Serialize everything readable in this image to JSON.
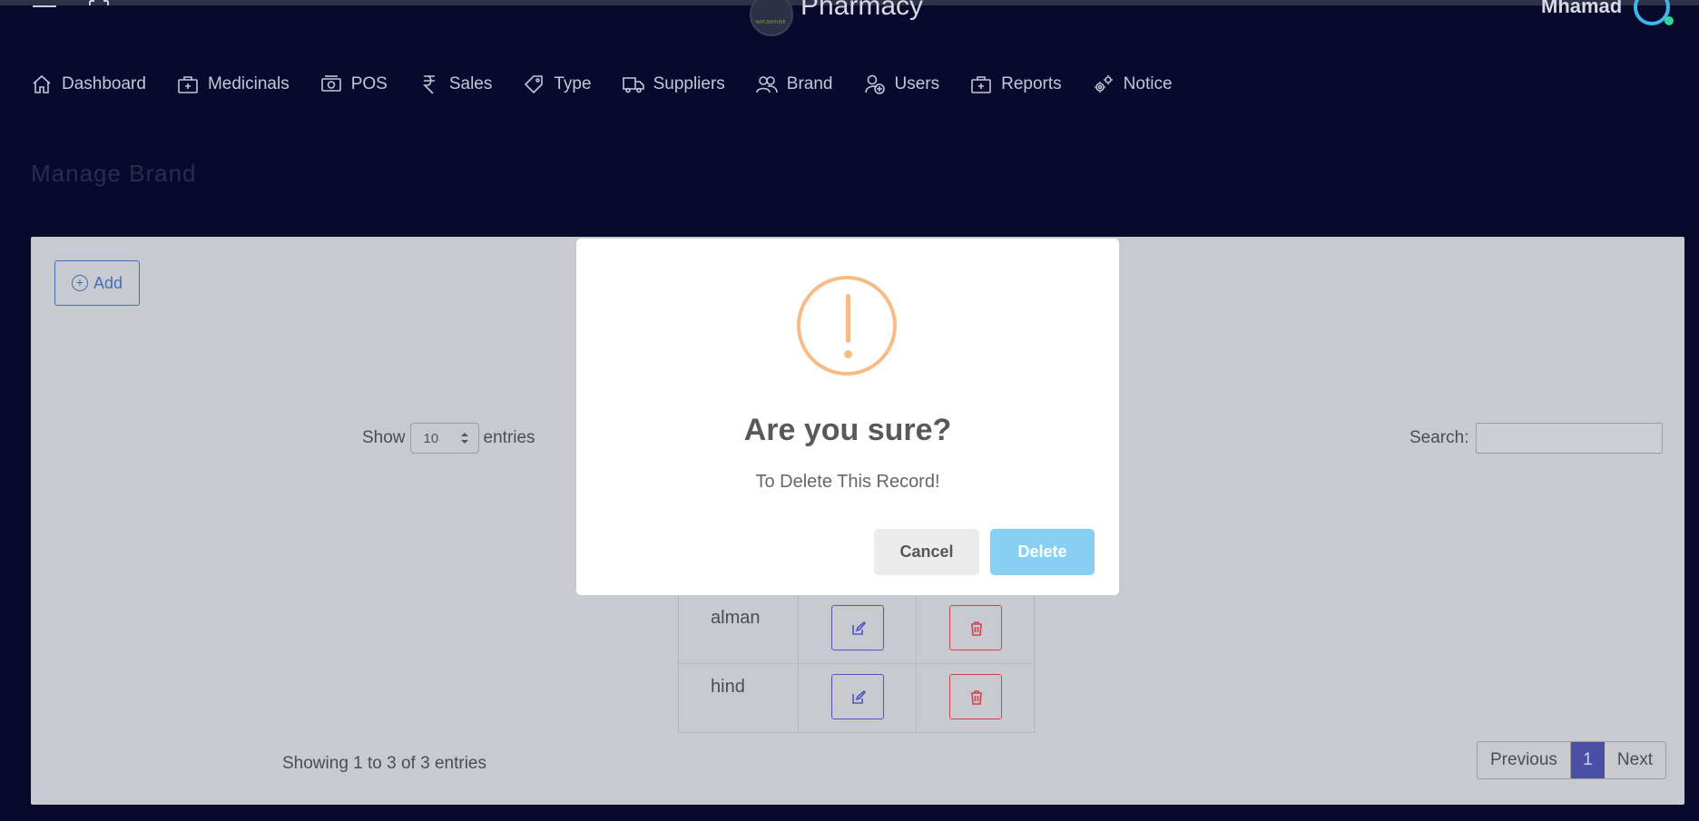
{
  "header": {
    "app_title": "Pharmacy",
    "logo_text": "NATUREPURE",
    "user_name": "Mhamad"
  },
  "nav": [
    {
      "label": "Dashboard",
      "icon": "home-icon"
    },
    {
      "label": "Medicinals",
      "icon": "medical-bag-icon"
    },
    {
      "label": "POS",
      "icon": "cash-icon"
    },
    {
      "label": "Sales",
      "icon": "rupee-icon"
    },
    {
      "label": "Type",
      "icon": "tag-icon"
    },
    {
      "label": "Suppliers",
      "icon": "truck-icon"
    },
    {
      "label": "Brand",
      "icon": "users-icon"
    },
    {
      "label": "Users",
      "icon": "user-add-icon"
    },
    {
      "label": "Reports",
      "icon": "medical-bag-icon"
    },
    {
      "label": "Notice",
      "icon": "gears-icon"
    }
  ],
  "page": {
    "title": "Manage Brand",
    "add_label": "Add"
  },
  "table_controls": {
    "show_label": "Show",
    "entries_value": "10",
    "entries_label": "entries",
    "search_label": "Search:"
  },
  "table": {
    "rows": [
      {
        "name": "alman"
      },
      {
        "name": "hind"
      }
    ]
  },
  "footer": {
    "showing": "Showing 1 to 3 of 3 entries",
    "previous": "Previous",
    "current_page": "1",
    "next": "Next"
  },
  "modal": {
    "title": "Are you sure?",
    "text": "To Delete This Record!",
    "cancel": "Cancel",
    "delete": "Delete"
  },
  "colors": {
    "background": "#070a2c",
    "warning": "#f8bb86",
    "delete_button": "#87d0f3",
    "pagination_active": "#4c4fa6"
  }
}
